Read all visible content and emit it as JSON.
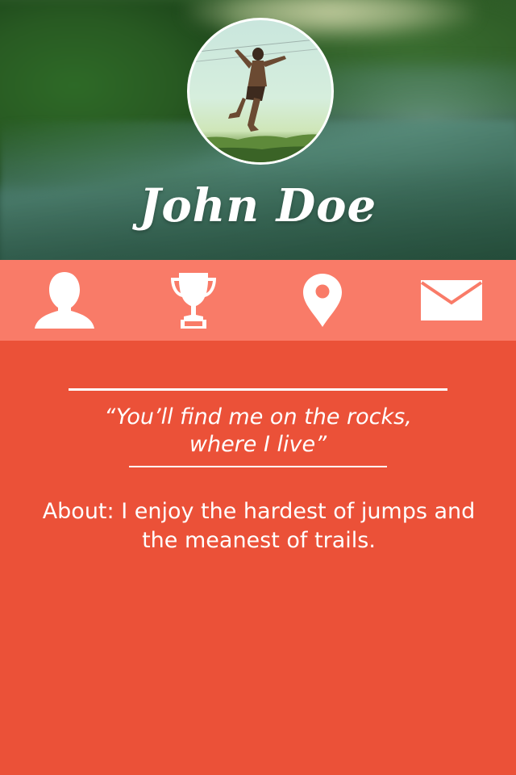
{
  "profile": {
    "name": "John Doe",
    "quote_line1": "“You’ll find me on the rocks,",
    "quote_line2": "where I live”",
    "about": "About: I enjoy the hardest of jumps and the meanest of trails."
  },
  "icons": {
    "profile": "user-icon",
    "achievements": "trophy-icon",
    "location": "map-pin-icon",
    "message": "envelope-icon"
  },
  "colors": {
    "primary": "#EB5138",
    "icon_bar": "#F97B68",
    "text": "#FFFFFF"
  }
}
